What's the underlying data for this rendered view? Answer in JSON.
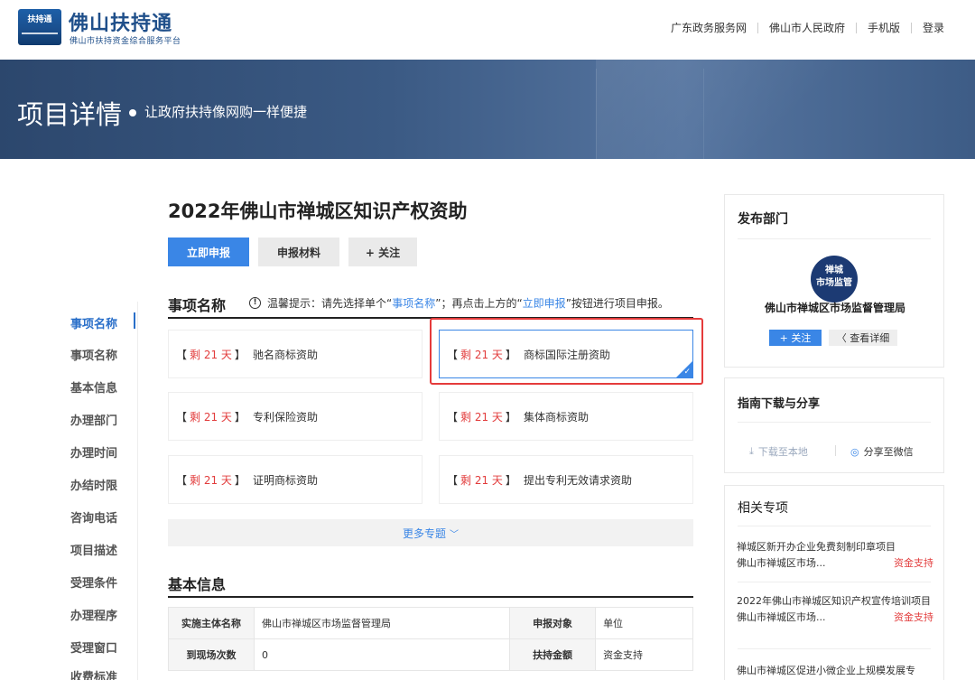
{
  "header": {
    "logo_text": "扶持通",
    "title": "佛山扶持通",
    "subtitle": "佛山市扶持资金综合服务平台",
    "nav": [
      "广东政务服务网",
      "佛山市人民政府",
      "手机版",
      "登录"
    ]
  },
  "banner": {
    "title": "项目详情",
    "subtitle": "让政府扶持像网购一样便捷"
  },
  "side_nav": {
    "items": [
      "事项名称",
      "事项名称",
      "基本信息",
      "办理部门",
      "办理时间",
      "办结时限",
      "咨询电话",
      "项目描述",
      "受理条件",
      "办理程序",
      "受理窗口",
      "收费标准"
    ]
  },
  "main": {
    "title": "2022年佛山市禅城区知识产权资助",
    "buttons": {
      "apply": "立即申报",
      "materials": "申报材料",
      "follow": "+ 关注"
    },
    "section_items": "事项名称",
    "tip": {
      "prefix": "温馨提示：请先选择单个“",
      "link1": "事项名称",
      "mid": "”；再点击上方的“",
      "link2": "立即申报",
      "suffix": "”按钮进行项目申报。"
    },
    "cards": [
      {
        "days": "剩 21 天",
        "name": "驰名商标资助"
      },
      {
        "days": "剩 21 天",
        "name": "商标国际注册资助"
      },
      {
        "days": "剩 21 天",
        "name": "专利保险资助"
      },
      {
        "days": "剩 21 天",
        "name": "集体商标资助"
      },
      {
        "days": "剩 21 天",
        "name": "证明商标资助"
      },
      {
        "days": "剩 21 天",
        "name": "提出专利无效请求资助"
      }
    ],
    "bracket_open": "【",
    "bracket_close": "】",
    "more": "更多专题",
    "section_basic": "基本信息",
    "basic_info": [
      [
        "实施主体名称",
        "佛山市禅城区市场监督管理局",
        "申报对象",
        "单位"
      ],
      [
        "到现场次数",
        "0",
        "扶持金额",
        "资金支持"
      ]
    ]
  },
  "right": {
    "dept": {
      "title": "发布部门",
      "logo_line1": "禅城",
      "logo_line2": "市场监管",
      "name": "佛山市禅城区市场监督管理局",
      "follow": "+ 关注",
      "detail": "〈 查看详细"
    },
    "guide": {
      "title": "指南下载与分享",
      "download": "下载至本地",
      "share": "分享至微信"
    },
    "related": {
      "title": "相关专项",
      "items": [
        {
          "title": "禅城区新开办企业免费刻制印章项目",
          "dept": "佛山市禅城区市场...",
          "tag": "资金支持"
        },
        {
          "title": "2022年佛山市禅城区知识产权宣传培训项目",
          "dept": "佛山市禅城区市场...",
          "tag": "资金支持"
        },
        {
          "title": "佛山市禅城区促进小微企业上规模发展专",
          "dept": "",
          "tag": ""
        }
      ]
    }
  },
  "colors": {
    "primary": "#3a86e6",
    "highlight": "#e53b3b",
    "days": "#e23c3c",
    "brand": "#1f4f8a"
  }
}
